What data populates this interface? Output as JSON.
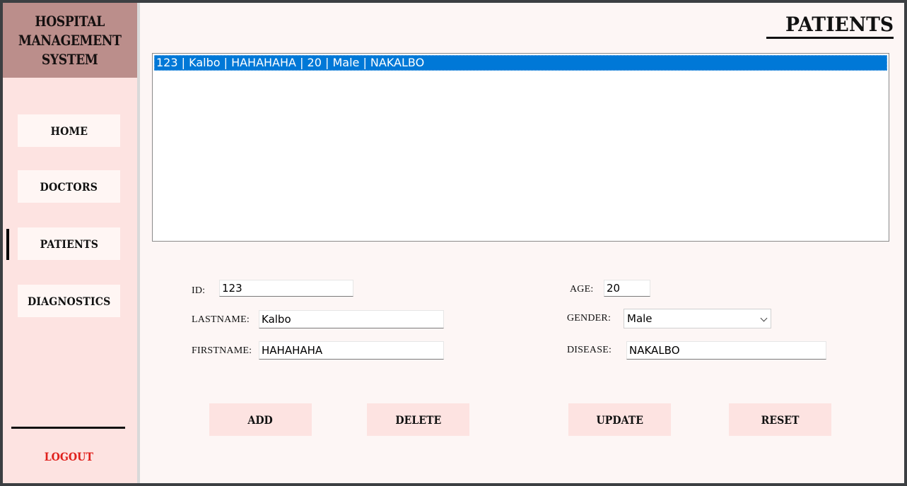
{
  "sidebar": {
    "brand_lines": [
      "HOSPITAL",
      "MANAGEMENT",
      "SYSTEM"
    ],
    "nav": {
      "home": "HOME",
      "doctors": "DOCTORS",
      "patients": "PATIENTS",
      "diagnostics": "DIAGNOSTICS"
    },
    "active_item": "PATIENTS",
    "logout": "LOGOUT"
  },
  "main": {
    "title": "PATIENTS",
    "patient_list": [
      "123 | Kalbo | HAHAHAHA | 20 | Male | NAKALBO"
    ],
    "selected_index": 0,
    "form": {
      "id_label": "ID:",
      "id_value": "123",
      "lastname_label": "LASTNAME:",
      "lastname_value": "Kalbo",
      "firstname_label": "FIRSTNAME:",
      "firstname_value": "HAHAHAHA",
      "age_label": "AGE:",
      "age_value": "20",
      "gender_label": "GENDER:",
      "gender_value": "Male",
      "disease_label": "DISEASE:",
      "disease_value": "NAKALBO"
    },
    "actions": {
      "add": "ADD",
      "delete": "DELETE",
      "update": "UPDATE",
      "reset": "RESET"
    }
  },
  "colors": {
    "brand_bg": "#bb8e8b",
    "sidebar_bg": "#fde3e1",
    "selection": "#0078d7",
    "logout_text": "#e0201c"
  }
}
